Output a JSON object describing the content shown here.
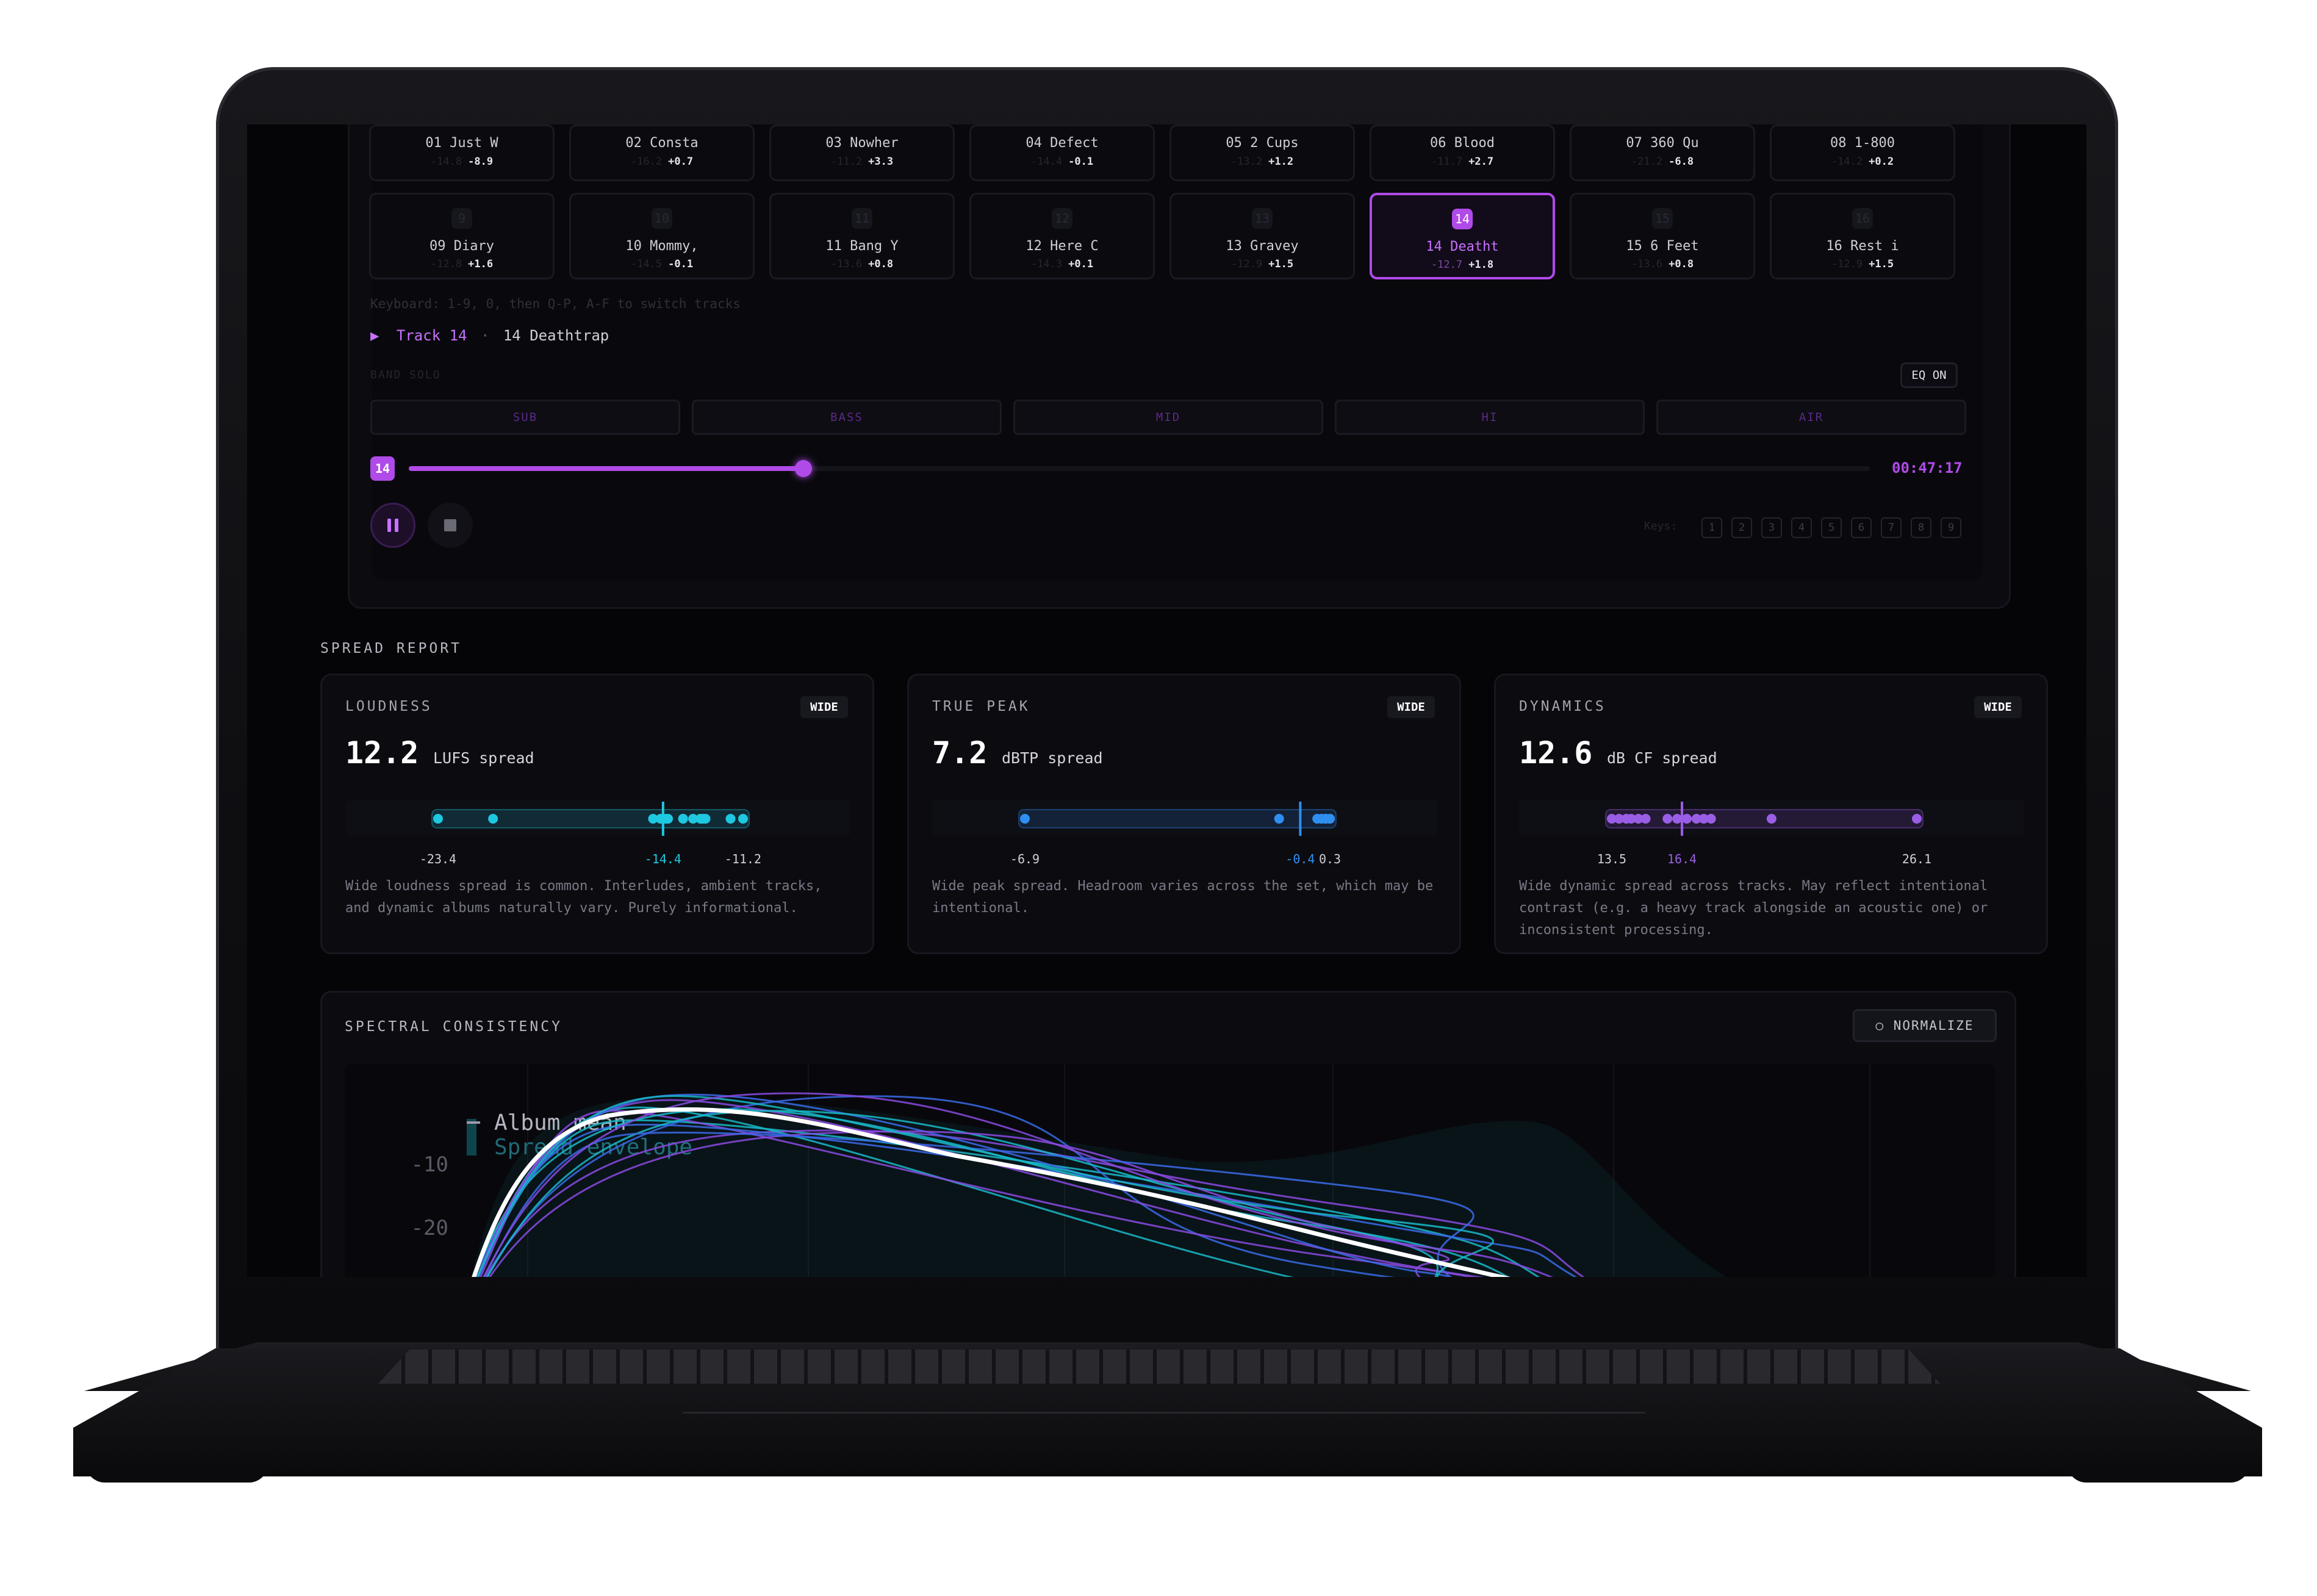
{
  "tracks_row1": [
    {
      "name": "01 Just W",
      "lufs": "-14.8",
      "delta": "-8.9"
    },
    {
      "name": "02 Consta",
      "lufs": "-16.2",
      "delta": "+0.7"
    },
    {
      "name": "03 Nowher",
      "lufs": "-11.2",
      "delta": "+3.3"
    },
    {
      "name": "04 Defect",
      "lufs": "-14.4",
      "delta": "-0.1"
    },
    {
      "name": "05 2 Cups",
      "lufs": "-13.2",
      "delta": "+1.2"
    },
    {
      "name": "06 Blood",
      "lufs": "-11.7",
      "delta": "+2.7"
    },
    {
      "name": "07 360 Qu",
      "lufs": "-21.2",
      "delta": "-6.8"
    },
    {
      "name": "08 1-800",
      "lufs": "-14.2",
      "delta": "+0.2"
    }
  ],
  "tracks_row2": [
    {
      "num": "9",
      "name": "09 Diary",
      "lufs": "-12.8",
      "delta": "+1.6"
    },
    {
      "num": "10",
      "name": "10 Mommy,",
      "lufs": "-14.5",
      "delta": "-0.1"
    },
    {
      "num": "11",
      "name": "11 Bang Y",
      "lufs": "-13.6",
      "delta": "+0.8"
    },
    {
      "num": "12",
      "name": "12 Here C",
      "lufs": "-14.3",
      "delta": "+0.1"
    },
    {
      "num": "13",
      "name": "13 Gravey",
      "lufs": "-12.9",
      "delta": "+1.5"
    },
    {
      "num": "14",
      "name": "14 Deatht",
      "lufs": "-12.7",
      "delta": "+1.8",
      "active": true
    },
    {
      "num": "15",
      "name": "15 6 Feet",
      "lufs": "-13.6",
      "delta": "+0.8"
    },
    {
      "num": "16",
      "name": "16 Rest i",
      "lufs": "-12.9",
      "delta": "+1.5"
    }
  ],
  "keyboard_hint": "Keyboard: 1-9, 0, then Q-P, A-F to switch tracks",
  "now_playing": {
    "label": "Track 14",
    "separator": "·",
    "title": "14 Deathtrap"
  },
  "band_solo_label": "BAND SOLO",
  "eq_label": "EQ ON",
  "bands": [
    "SUB",
    "BASS",
    "MID",
    "HI",
    "AIR"
  ],
  "player": {
    "badge": "14",
    "progress": 0.27,
    "time": "00:47:17",
    "keys_label": "Keys:",
    "keys": [
      "1",
      "2",
      "3",
      "4",
      "5",
      "6",
      "7",
      "8",
      "9"
    ]
  },
  "spread_report_title": "SPREAD REPORT",
  "cards": [
    {
      "title": "LOUDNESS",
      "badge": "WIDE",
      "value": "12.2",
      "unit": "LUFS spread",
      "min": -23.4,
      "max": -11.2,
      "marker": -14.4,
      "min_label": "-23.4",
      "marker_label": "-14.4",
      "max_label": "-11.2",
      "points": [
        -23.4,
        -21.2,
        -14.8,
        -14.5,
        -14.4,
        -14.3,
        -14.2,
        -13.6,
        -13.6,
        -13.2,
        -12.9,
        -12.9,
        -12.8,
        -12.7,
        -11.7,
        -11.2
      ],
      "color": "#1ec8e0",
      "desc": "Wide loudness spread is common. Interludes, ambient tracks, and dynamic albums naturally vary. Purely informational."
    },
    {
      "title": "TRUE PEAK",
      "badge": "WIDE",
      "value": "7.2",
      "unit": "dBTP spread",
      "min": -6.9,
      "max": 0.3,
      "marker": -0.4,
      "min_label": "-6.9",
      "marker_label": "-0.4",
      "max_label": "0.3",
      "points": [
        -6.9,
        -0.9,
        0.0,
        0.1,
        0.1,
        0.2,
        0.2,
        0.2,
        0.3,
        0.3,
        0.3,
        0.3
      ],
      "color": "#2f8ff0",
      "desc": "Wide peak spread. Headroom varies across the set, which may be intentional."
    },
    {
      "title": "DYNAMICS",
      "badge": "WIDE",
      "value": "12.6",
      "unit": "dB CF spread",
      "min": 13.5,
      "max": 26.1,
      "marker": 16.4,
      "min_label": "13.5",
      "marker_label": "16.4",
      "max_label": "26.1",
      "points": [
        13.5,
        13.8,
        14.1,
        14.3,
        14.6,
        14.9,
        15.8,
        16.2,
        16.6,
        17.0,
        17.3,
        17.6,
        20.1,
        26.1
      ],
      "color": "#9a5ee6",
      "desc": "Wide dynamic spread across tracks. May reflect intentional contrast (e.g. a heavy track alongside an acoustic one) or inconsistent processing."
    }
  ],
  "spectral": {
    "title": "SPECTRAL CONSISTENCY",
    "normalize_label": "○ NORMALIZE",
    "legend_mean": "Album mean",
    "legend_envelope": "Spread envelope",
    "y_ticks": [
      "-10",
      "-20"
    ],
    "colors": {
      "mean": "#ffffff",
      "teal": "#19b8c8",
      "purple": "#8a4ae0",
      "blue": "#3a6ae8"
    }
  }
}
